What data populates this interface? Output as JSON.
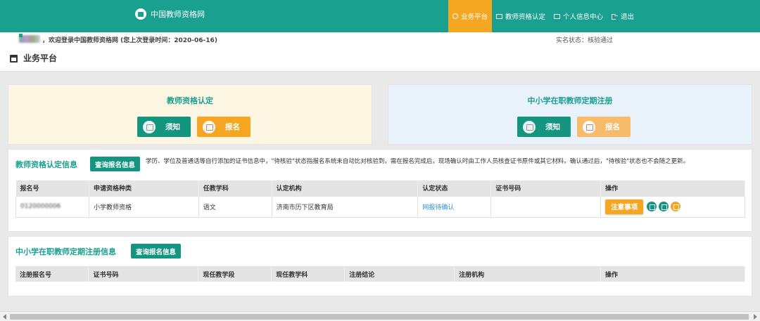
{
  "header": {
    "site_title": "中国教师资格网",
    "nav": [
      {
        "label": "业务平台",
        "active": true,
        "icon": "platform-icon"
      },
      {
        "label": "教师资格认定",
        "active": false,
        "icon": "monitor-icon"
      },
      {
        "label": "个人信息中心",
        "active": false,
        "icon": "monitor-icon"
      },
      {
        "label": "退出",
        "active": false,
        "icon": "exit-icon"
      }
    ]
  },
  "welcome": {
    "message": "，欢迎登录中国教师资格网 (您上次登录时间：2020-06-16)",
    "status": "实名状态：核验通过"
  },
  "page": {
    "title": "业务平台"
  },
  "cards": {
    "left": {
      "title": "教师资格认定",
      "notice_label": "须知",
      "apply_label": "报名"
    },
    "right": {
      "title": "中小学在职教师定期注册",
      "notice_label": "须知",
      "apply_label": "报名"
    }
  },
  "certification": {
    "title": "教师资格认定信息",
    "query_label": "查询报名信息",
    "notice_text": "学历、学位及普通话等自行添加的证书信息中，\"待核验\"状态指报名系统未自动比对核验到，需在报名完成后，现场确认时由工作人员核查证书原件或其它材料。确认通过后，\"待核验\"状态也不会随之更新。",
    "columns": [
      "报名号",
      "申请资格种类",
      "任教学科",
      "认定机构",
      "认定状态",
      "证书号码",
      "操作"
    ],
    "rows": [
      {
        "id": "0120000006",
        "type": "小学教师资格",
        "subject": "语文",
        "agency": "济南市历下区教育局",
        "status": "网报待确认",
        "cert_no": "",
        "action_label": "注意事项"
      }
    ]
  },
  "registration": {
    "title": "中小学在职教师定期注册信息",
    "query_label": "查询报名信息",
    "columns": [
      "注册报名号",
      "证书号码",
      "现任教学段",
      "现任教学科",
      "注册结论",
      "注册机构",
      "操作"
    ]
  },
  "colors": {
    "primary": "#1aa08e",
    "button_teal": "#13957f",
    "accent_orange": "#f5a623",
    "link": "#2e8fd6"
  }
}
